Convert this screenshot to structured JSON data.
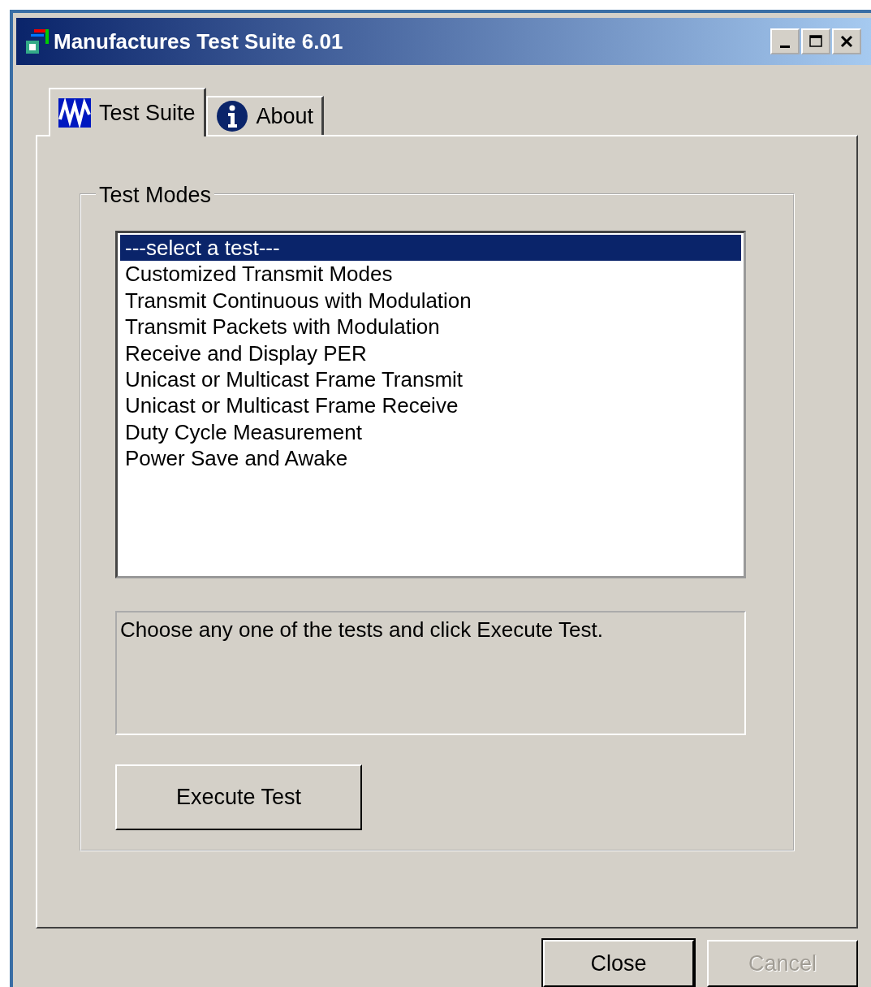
{
  "window": {
    "title": "Manufactures Test Suite 6.01"
  },
  "tabs": [
    {
      "label": "Test Suite",
      "kind": "wave",
      "selected": true
    },
    {
      "label": "About",
      "kind": "info",
      "selected": false
    }
  ],
  "group": {
    "title": "Test Modes"
  },
  "tests": [
    {
      "label": "---select a test---",
      "selected": true
    },
    {
      "label": "Customized Transmit Modes",
      "selected": false
    },
    {
      "label": "Transmit Continuous with Modulation",
      "selected": false
    },
    {
      "label": "Transmit Packets with Modulation",
      "selected": false
    },
    {
      "label": "Receive and Display PER",
      "selected": false
    },
    {
      "label": "Unicast or Multicast Frame Transmit",
      "selected": false
    },
    {
      "label": "Unicast or Multicast Frame Receive",
      "selected": false
    },
    {
      "label": "Duty Cycle Measurement",
      "selected": false
    },
    {
      "label": "Power Save and Awake",
      "selected": false
    }
  ],
  "description": "Choose any one of the tests and click Execute Test.",
  "execute_button": {
    "label": "Execute Test"
  },
  "buttons": [
    {
      "label": "Close",
      "disabled": false,
      "default": true
    },
    {
      "label": "Cancel",
      "disabled": true,
      "default": false
    }
  ]
}
